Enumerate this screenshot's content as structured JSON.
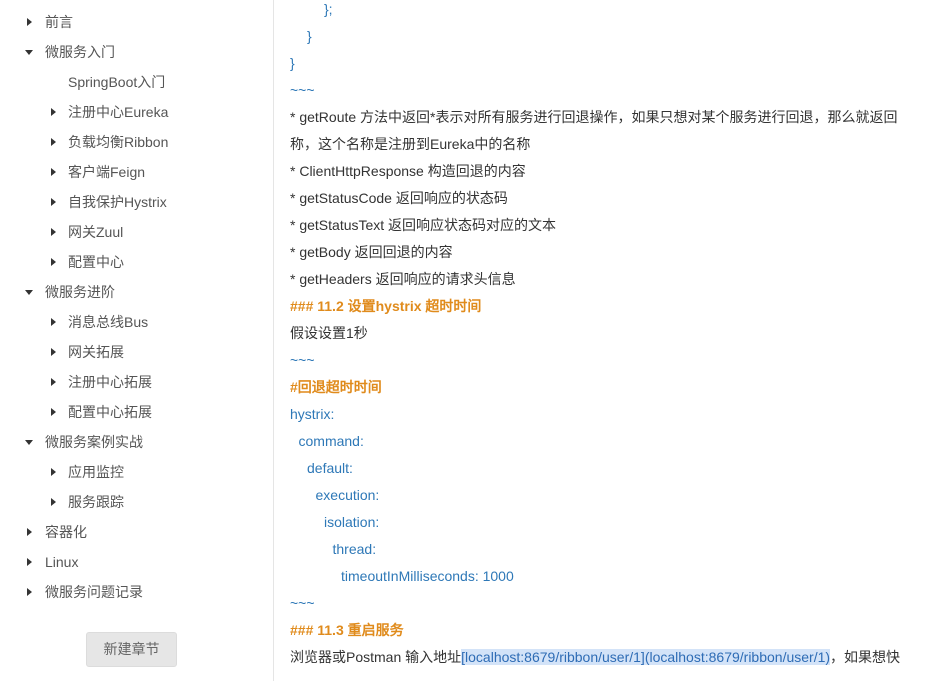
{
  "sidebar": {
    "items": [
      {
        "level": 0,
        "state": "collapsed",
        "label": "前言"
      },
      {
        "level": 0,
        "state": "expanded",
        "label": "微服务入门"
      },
      {
        "level": 1,
        "state": "leaf",
        "label": "SpringBoot入门"
      },
      {
        "level": 1,
        "state": "collapsed",
        "label": "注册中心Eureka"
      },
      {
        "level": 1,
        "state": "collapsed",
        "label": "负载均衡Ribbon"
      },
      {
        "level": 1,
        "state": "collapsed",
        "label": "客户端Feign"
      },
      {
        "level": 1,
        "state": "collapsed",
        "label": "自我保护Hystrix"
      },
      {
        "level": 1,
        "state": "collapsed",
        "label": "网关Zuul"
      },
      {
        "level": 1,
        "state": "collapsed",
        "label": "配置中心"
      },
      {
        "level": 0,
        "state": "expanded",
        "label": "微服务进阶"
      },
      {
        "level": 1,
        "state": "collapsed",
        "label": "消息总线Bus"
      },
      {
        "level": 1,
        "state": "collapsed",
        "label": "网关拓展"
      },
      {
        "level": 1,
        "state": "collapsed",
        "label": "注册中心拓展"
      },
      {
        "level": 1,
        "state": "collapsed",
        "label": "配置中心拓展"
      },
      {
        "level": 0,
        "state": "expanded",
        "label": "微服务案例实战"
      },
      {
        "level": 1,
        "state": "collapsed",
        "label": "应用监控"
      },
      {
        "level": 1,
        "state": "collapsed",
        "label": "服务跟踪"
      },
      {
        "level": 0,
        "state": "collapsed",
        "label": "容器化"
      },
      {
        "level": 0,
        "state": "collapsed",
        "label": "Linux"
      },
      {
        "level": 0,
        "state": "collapsed",
        "label": "微服务问题记录"
      }
    ],
    "new_chapter_label": "新建章节"
  },
  "editor": {
    "lines": [
      {
        "style": "blue",
        "indent": 4,
        "text": "};"
      },
      {
        "style": "blue",
        "indent": 2,
        "text": "}"
      },
      {
        "style": "blue",
        "indent": 0,
        "text": "}"
      },
      {
        "style": "blue",
        "indent": 0,
        "text": "~~~"
      },
      {
        "style": "text",
        "indent": 0,
        "text": "* getRoute 方法中返回*表示对所有服务进行回退操作，如果只想对某个服务进行回退，那么就返回"
      },
      {
        "style": "text",
        "indent": 0,
        "text": "称，这个名称是注册到Eureka中的名称"
      },
      {
        "style": "text",
        "indent": 0,
        "text": "* ClientHttpResponse 构造回退的内容"
      },
      {
        "style": "text",
        "indent": 0,
        "text": "* getStatusCode 返回响应的状态码"
      },
      {
        "style": "text",
        "indent": 0,
        "text": "* getStatusText 返回响应状态码对应的文本"
      },
      {
        "style": "text",
        "indent": 0,
        "text": "* getBody 返回回退的内容"
      },
      {
        "style": "text",
        "indent": 0,
        "text": "* getHeaders 返回响应的请求头信息"
      },
      {
        "style": "heading",
        "indent": 0,
        "text": "### 11.2 设置hystrix 超时时间"
      },
      {
        "style": "text",
        "indent": 0,
        "text": "假设设置1秒"
      },
      {
        "style": "blue",
        "indent": 0,
        "text": "~~~"
      },
      {
        "style": "heading",
        "indent": 0,
        "text": "#回退超时时间"
      },
      {
        "style": "blue",
        "indent": 0,
        "text": "hystrix:"
      },
      {
        "style": "blue",
        "indent": 1,
        "text": "command:"
      },
      {
        "style": "blue",
        "indent": 2,
        "text": "default:"
      },
      {
        "style": "blue",
        "indent": 3,
        "text": "execution:"
      },
      {
        "style": "blue",
        "indent": 4,
        "text": "isolation:"
      },
      {
        "style": "blue",
        "indent": 5,
        "text": "thread:"
      },
      {
        "style": "blue",
        "indent": 6,
        "text": "timeoutInMilliseconds: 1000"
      },
      {
        "style": "blue",
        "indent": 0,
        "text": "~~~"
      },
      {
        "style": "heading",
        "indent": 0,
        "text": "### 11.3 重启服务"
      }
    ],
    "last_line": {
      "prefix": "浏览器或Postman 输入地址",
      "link": "[localhost:8679/ribbon/user/1](localhost:8679/ribbon/user/1)",
      "suffix": "，如果想快"
    }
  },
  "colors": {
    "code_blue": "#2e78b7",
    "heading_orange": "#e08b1c",
    "body_text": "#333333",
    "link_highlight": "#d3e3f8"
  },
  "icons": {
    "collapsed": "triangle-right-icon",
    "expanded": "triangle-down-icon"
  }
}
